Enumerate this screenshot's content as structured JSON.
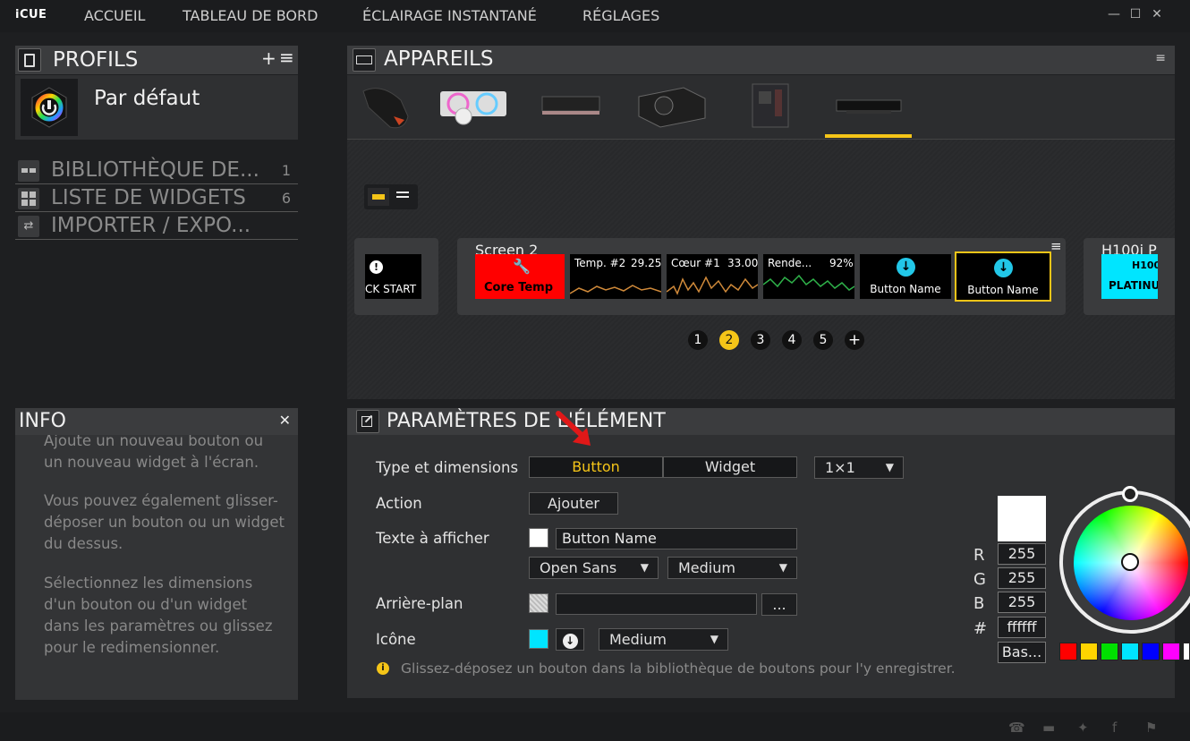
{
  "app": {
    "logo": "iCUE"
  },
  "nav": [
    "ACCUEIL",
    "TABLEAU DE BORD",
    "ÉCLAIRAGE INSTANTANÉ",
    "RÉGLAGES"
  ],
  "window": {
    "minimize": "—",
    "maximize": "☐",
    "close": "✕"
  },
  "profiles": {
    "title": "PROFILS",
    "add": "+",
    "menu": "≡",
    "items": [
      {
        "name": "Par défaut"
      }
    ]
  },
  "library": [
    {
      "label": "BIBLIOTHÈQUE DE...",
      "count": "1"
    },
    {
      "label": "LISTE DE WIDGETS",
      "count": "6"
    },
    {
      "label": "IMPORTER / EXPO...",
      "count": ""
    }
  ],
  "info": {
    "title": "INFO",
    "close": "✕",
    "paragraphs": [
      "Ajoute un nouveau bouton ou un nouveau widget à l'écran.",
      "Vous pouvez également glisser-déposer un bouton ou un widget du dessus.",
      "Sélectionnez les dimensions d'un bouton ou d'un widget dans les paramètres ou glissez pour le redimensionner."
    ]
  },
  "devices": {
    "title": "APPAREILS",
    "thumbs": [
      "mouse",
      "aio-cooler",
      "ram",
      "psu",
      "motherboard",
      "lcd-screen"
    ],
    "selected_index": 5
  },
  "screens": {
    "left_partial": {
      "label": "CK START",
      "icon": "!"
    },
    "current": {
      "title": "Screen 2",
      "tiles": [
        {
          "type": "core-temp",
          "text": "Core Temp",
          "icon": "wrench"
        },
        {
          "type": "sensor",
          "label": "Temp. #2",
          "value": "29.25",
          "color": "#d08a3a"
        },
        {
          "type": "sensor",
          "label": "Cœur #1",
          "value": "33.00",
          "color": "#d08a3a"
        },
        {
          "type": "sensor",
          "label": "Rende...",
          "value": "92%",
          "color": "#2fb34a"
        },
        {
          "type": "button",
          "label": "Button Name"
        },
        {
          "type": "button",
          "label": "Button Name",
          "selected": true
        }
      ]
    },
    "right_partial": {
      "title": "H100i P",
      "lines": [
        "H100",
        "PLATINUI"
      ]
    },
    "pager": [
      "1",
      "2",
      "3",
      "4",
      "5",
      "+"
    ],
    "active_page": "2"
  },
  "params": {
    "title": "PARAMÈTRES DE L'ÉLÉMENT",
    "type_label": "Type et dimensions",
    "type_options": [
      "Button",
      "Widget"
    ],
    "type_selected": "Button",
    "size_value": "1×1",
    "action_label": "Action",
    "action_button": "Ajouter",
    "text_label": "Texte à afficher",
    "text_value": "Button Name",
    "font_value": "Open Sans",
    "weight_value": "Medium",
    "bg_label": "Arrière-plan",
    "bg_value": "",
    "bg_more": "...",
    "icon_label": "Icône",
    "icon_size": "Medium",
    "hint": "Glissez-déposez un bouton dans la bibliothèque de boutons pour l'y enregistrer."
  },
  "color": {
    "r_label": "R",
    "g_label": "G",
    "b_label": "B",
    "hex_label": "#",
    "r": "255",
    "g": "255",
    "b": "255",
    "hex": "ffffff",
    "basic_button": "Bas...",
    "palette": [
      "#ff0000",
      "#ffd400",
      "#00e000",
      "#00e5ff",
      "#0000ff",
      "#ff00ff",
      "#ffffff"
    ]
  }
}
